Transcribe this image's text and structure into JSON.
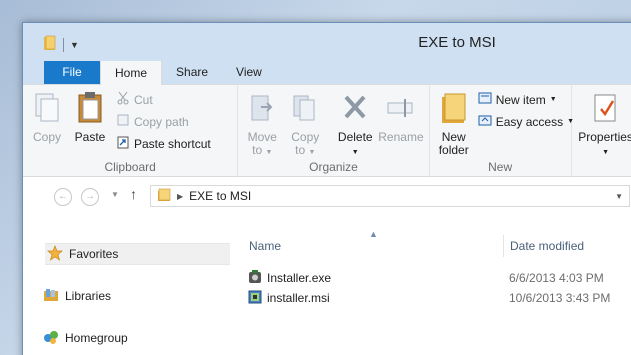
{
  "window": {
    "title": "EXE to MSI"
  },
  "tabs": [
    {
      "label": "File"
    },
    {
      "label": "Home"
    },
    {
      "label": "Share"
    },
    {
      "label": "View"
    }
  ],
  "ribbon": {
    "clipboard": {
      "label": "Clipboard",
      "copy": "Copy",
      "paste": "Paste",
      "cut": "Cut",
      "copy_path": "Copy path",
      "paste_shortcut": "Paste shortcut"
    },
    "organize": {
      "label": "Organize",
      "move_to_line1": "Move",
      "move_to_line2": "to",
      "copy_to_line1": "Copy",
      "copy_to_line2": "to",
      "delete": "Delete",
      "rename": "Rename"
    },
    "new": {
      "label": "New",
      "new_folder_line1": "New",
      "new_folder_line2": "folder",
      "new_item": "New item",
      "easy_access": "Easy access"
    },
    "open": {
      "properties": "Properties"
    }
  },
  "address": {
    "path": "EXE to MSI"
  },
  "navpane": {
    "items": [
      {
        "label": "Favorites"
      },
      {
        "label": "Libraries"
      },
      {
        "label": "Homegroup"
      }
    ]
  },
  "filelist": {
    "columns": {
      "name": "Name",
      "date": "Date modified"
    },
    "files": [
      {
        "name": "Installer.exe",
        "date": "6/6/2013 4:03 PM"
      },
      {
        "name": "installer.msi",
        "date": "10/6/2013 3:43 PM"
      }
    ]
  }
}
